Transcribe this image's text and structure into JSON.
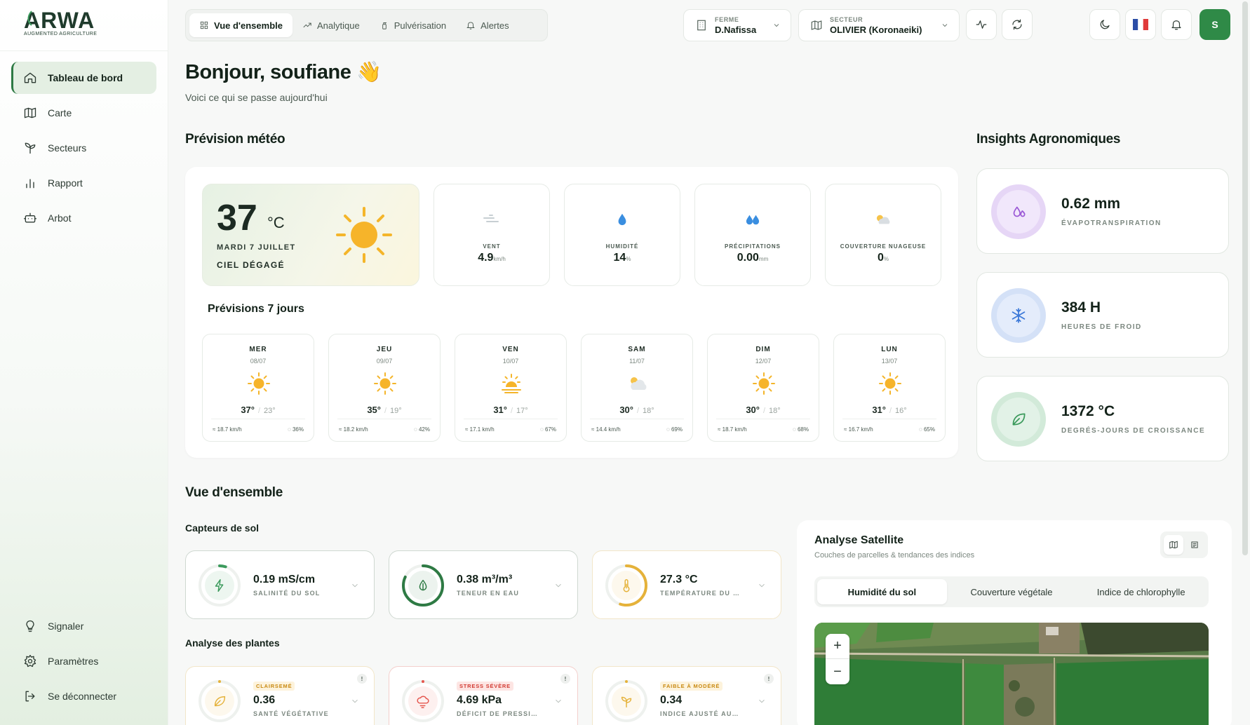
{
  "brand": {
    "logo_text": "ARWA",
    "tagline": "AUGMENTED AGRICULTURE"
  },
  "sidebar": {
    "items": [
      {
        "label": "Tableau de bord",
        "icon": "home-icon"
      },
      {
        "label": "Carte",
        "icon": "map-icon"
      },
      {
        "label": "Secteurs",
        "icon": "sprout-icon"
      },
      {
        "label": "Rapport",
        "icon": "bar-chart-icon"
      },
      {
        "label": "Arbot",
        "icon": "robot-icon"
      }
    ],
    "bottom": [
      {
        "label": "Signaler",
        "icon": "lightbulb-icon"
      },
      {
        "label": "Paramètres",
        "icon": "gear-icon"
      },
      {
        "label": "Se déconnecter",
        "icon": "logout-icon"
      }
    ]
  },
  "topbar": {
    "tabs": [
      {
        "label": "Vue d'ensemble",
        "icon": "grid-icon"
      },
      {
        "label": "Analytique",
        "icon": "trend-icon"
      },
      {
        "label": "Pulvérisation",
        "icon": "spray-icon"
      },
      {
        "label": "Alertes",
        "icon": "bell-icon"
      }
    ],
    "farm": {
      "label": "FERME",
      "value": "D.Nafissa"
    },
    "sector": {
      "label": "SECTEUR",
      "value": "OLIVIER (Koronaeiki)"
    },
    "avatar": "S"
  },
  "greeting": {
    "title": "Bonjour, soufiane 👋",
    "subtitle": "Voici ce qui se passe aujourd'hui"
  },
  "weather": {
    "section_title": "Prévision météo",
    "today": {
      "temp": "37",
      "unit": "°C",
      "date": "MARDI 7 JUILLET",
      "condition": "CIEL DÉGAGÉ"
    },
    "stats": [
      {
        "label": "VENT",
        "value": "4.9",
        "unit": "km/h",
        "icon": "wind-icon"
      },
      {
        "label": "HUMIDITÉ",
        "value": "14",
        "unit": "%",
        "icon": "humidity-drop-icon"
      },
      {
        "label": "PRÉCIPITATIONS",
        "value": "0.00",
        "unit": "mm",
        "icon": "rain-drops-icon"
      },
      {
        "label": "COUVERTURE NUAGEUSE",
        "value": "0",
        "unit": "%",
        "icon": "cloud-sun-icon"
      }
    ],
    "forecast_title": "Prévisions 7 jours",
    "forecast": [
      {
        "day": "MER",
        "date": "08/07",
        "high": "37°",
        "low": "23°",
        "wind": "18.7 km/h",
        "hum": "36%",
        "icon": "sun-icon"
      },
      {
        "day": "JEU",
        "date": "09/07",
        "high": "35°",
        "low": "19°",
        "wind": "18.2 km/h",
        "hum": "42%",
        "icon": "sun-icon"
      },
      {
        "day": "VEN",
        "date": "10/07",
        "high": "31°",
        "low": "17°",
        "wind": "17.1 km/h",
        "hum": "67%",
        "icon": "sunrise-icon"
      },
      {
        "day": "SAM",
        "date": "11/07",
        "high": "30°",
        "low": "18°",
        "wind": "14.4 km/h",
        "hum": "69%",
        "icon": "cloud-sun-icon"
      },
      {
        "day": "DIM",
        "date": "12/07",
        "high": "30°",
        "low": "18°",
        "wind": "18.7 km/h",
        "hum": "68%",
        "icon": "sun-icon"
      },
      {
        "day": "LUN",
        "date": "13/07",
        "high": "31°",
        "low": "16°",
        "wind": "16.7 km/h",
        "hum": "65%",
        "icon": "sun-icon"
      }
    ]
  },
  "insights": {
    "title": "Insights Agronomiques",
    "items": [
      {
        "value": "0.62 mm",
        "label": "ÉVAPOTRANSPIRATION",
        "icon": "droplets-icon",
        "color": "#9b59d6"
      },
      {
        "value": "384 H",
        "label": "HEURES DE FROID",
        "icon": "snowflake-icon",
        "color": "#3b78d8"
      },
      {
        "value": "1372 °C",
        "label": "DEGRÉS-JOURS DE CROISSANCE",
        "icon": "leaf-icon",
        "color": "#3b9a5c"
      }
    ]
  },
  "overview": {
    "title": "Vue d'ensemble",
    "soil_title": "Capteurs de sol",
    "soil": [
      {
        "value": "0.19 mS/cm",
        "label": "SALINITÉ DU SOL",
        "icon": "lightning-icon",
        "color": "#3b9a5c",
        "level": 0.05
      },
      {
        "value": "0.38 m³/m³",
        "label": "TENEUR EN EAU",
        "icon": "water-drop-icon",
        "color": "#2e7a44",
        "level": 0.82
      },
      {
        "value": "27.3 °C",
        "label": "TEMPÉRATURE DU …",
        "icon": "thermometer-icon",
        "color": "#e5b23a",
        "level": 0.55
      }
    ],
    "plants_title": "Analyse des plantes",
    "plants": [
      {
        "badge": "CLAIRSEMÉ",
        "value": "0.36",
        "label": "SANTÉ VÉGÉTATIVE",
        "icon": "leaf-icon",
        "color": "#e5b23a",
        "badge_color": "#c98a12",
        "badge_bg": "#fdf3dc"
      },
      {
        "badge": "STRESS SÉVÈRE",
        "value": "4.69 kPa",
        "label": "DÉFICIT DE PRESSI…",
        "icon": "cloud-wind-icon",
        "color": "#e5574f",
        "badge_color": "#d23a32",
        "badge_bg": "#fde5e3"
      },
      {
        "badge": "FAIBLE À MODÉRÉ",
        "value": "0.34",
        "label": "INDICE AJUSTÉ AU…",
        "icon": "sprout-icon",
        "color": "#e5b23a",
        "badge_color": "#c98a12",
        "badge_bg": "#fdf3dc"
      }
    ],
    "info_glyph": "!"
  },
  "satellite": {
    "title": "Analyse Satellite",
    "subtitle": "Couches de parcelles & tendances des indices",
    "tabs": [
      "Humidité du sol",
      "Couverture végétale",
      "Indice de chlorophylle"
    ],
    "zoom_in": "+",
    "zoom_out": "−"
  }
}
